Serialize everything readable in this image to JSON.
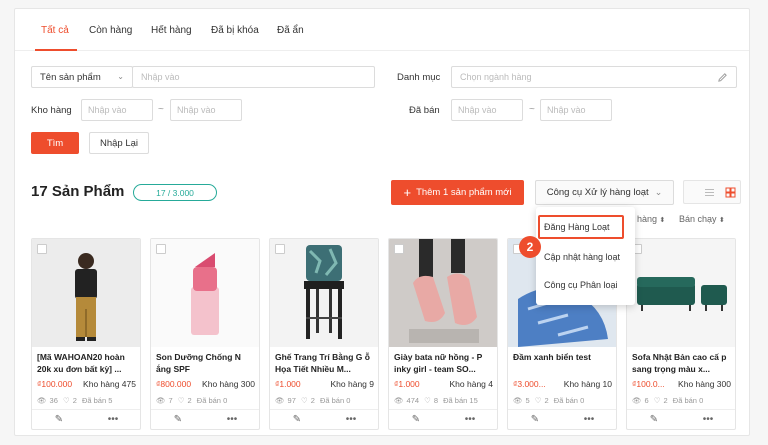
{
  "tabs": [
    "Tất cả",
    "Còn hàng",
    "Hết hàng",
    "Đã bị khóa",
    "Đã ẩn"
  ],
  "filters": {
    "product_name_select": "Tên sản phẩm",
    "product_name_placeholder": "Nhập vào",
    "category_label": "Danh mục",
    "category_placeholder": "Chọn ngành hàng",
    "stock_label": "Kho hàng",
    "stock_from_placeholder": "Nhập vào",
    "stock_to_placeholder": "Nhập vào",
    "sold_label": "Đã bán",
    "sold_from_placeholder": "Nhập vào",
    "sold_to_placeholder": "Nhập vào",
    "range_sep": "~",
    "search_button": "Tìm",
    "reset_button": "Nhập Lại"
  },
  "summary": {
    "count_title": "17 Sản Phẩm",
    "quota": "17 / 3.000",
    "add_button": "Thêm 1 sản phẩm mới",
    "add_icon": "+",
    "bulk_tools_button": "Công cụ Xử lý hàng loạt",
    "sort_stock": "hàng",
    "sort_bestseller": "Bán chạy"
  },
  "dropdown": {
    "items": [
      "Đăng Hàng Loạt",
      "Cập nhật hàng loạt",
      "Công cụ Phân loại"
    ],
    "step_badge": "2"
  },
  "products": [
    {
      "name": "[Mã WAHOAN20 hoàn 20k xu đơn bất kỳ] ...",
      "price": "₫100.000",
      "stock": "Kho hàng 475",
      "views": "36",
      "likes": "2",
      "sold": "Đã bán 5"
    },
    {
      "name": "Son Dưỡng Chống N ắng SPF",
      "price": "₫800.000",
      "stock": "Kho hàng 300",
      "views": "7",
      "likes": "2",
      "sold": "Đã bán 0"
    },
    {
      "name": "Ghế Trang Trí Bằng G ỗ Họa Tiết Nhiều M...",
      "price": "₫1.000",
      "stock": "Kho hàng 9",
      "views": "97",
      "likes": "2",
      "sold": "Đã bán 0"
    },
    {
      "name": "Giày bata nữ hồng - P inky girl - team SO...",
      "price": "₫1.000",
      "stock": "Kho hàng 4",
      "views": "474",
      "likes": "8",
      "sold": "Đã bán 15"
    },
    {
      "name": "Đầm xanh biển test",
      "price": "₫3.000...",
      "stock": "Kho hàng 10",
      "views": "5",
      "likes": "2",
      "sold": "Đã bán 0"
    },
    {
      "name": "Sofa Nhật Bản cao cấ p sang trọng màu x...",
      "price": "₫100.0...",
      "stock": "Kho hàng 300",
      "views": "6",
      "likes": "2",
      "sold": "Đã bán 0"
    }
  ],
  "colors": {
    "accent": "#ee4d2d",
    "teal": "#26aa99"
  }
}
